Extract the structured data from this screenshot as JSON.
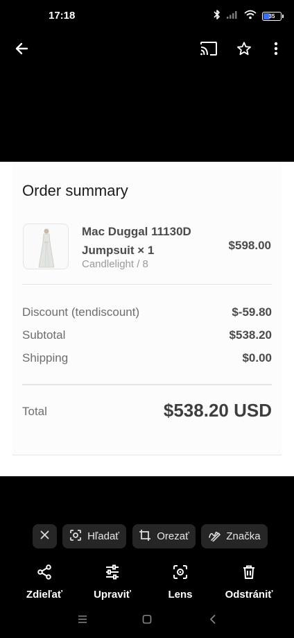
{
  "status_bar": {
    "time": "17:18",
    "battery_level": "35",
    "icons": [
      "bluetooth-icon",
      "signal-icon",
      "wifi-icon",
      "battery-icon"
    ]
  },
  "top_bar": {
    "icons": [
      "back-arrow-icon",
      "cast-icon",
      "star-icon",
      "more-vert-icon"
    ]
  },
  "order": {
    "title": "Order summary",
    "item": {
      "name": "Mac Duggal 11130D Jumpsuit × 1",
      "variant": "Candlelight / 8",
      "price": "$598.00",
      "thumbnail_icon": "dress-thumbnail"
    },
    "lines": [
      {
        "label": "Discount (tendiscount)",
        "value": "$-59.80"
      },
      {
        "label": "Subtotal",
        "value": "$538.20"
      },
      {
        "label": "Shipping",
        "value": "$0.00"
      }
    ],
    "total": {
      "label": "Total",
      "value": "$538.20 USD"
    }
  },
  "chips": [
    {
      "label": "",
      "icon": "close-icon"
    },
    {
      "label": "Hľadať",
      "icon": "search-lens-icon"
    },
    {
      "label": "Orezať",
      "icon": "crop-icon"
    },
    {
      "label": "Značka",
      "icon": "markup-icon"
    }
  ],
  "actions": [
    {
      "label": "Zdieľať",
      "icon": "share-icon"
    },
    {
      "label": "Upraviť",
      "icon": "edit-sliders-icon"
    },
    {
      "label": "Lens",
      "icon": "lens-icon"
    },
    {
      "label": "Odstrániť",
      "icon": "delete-icon"
    }
  ],
  "nav_bar": {
    "icons": [
      "recents-icon",
      "home-icon",
      "back-icon"
    ]
  },
  "colors": {
    "background": "#000000",
    "card": "#fcfcfd",
    "chip": "#262626",
    "battery_accent": "#3b6df5"
  }
}
